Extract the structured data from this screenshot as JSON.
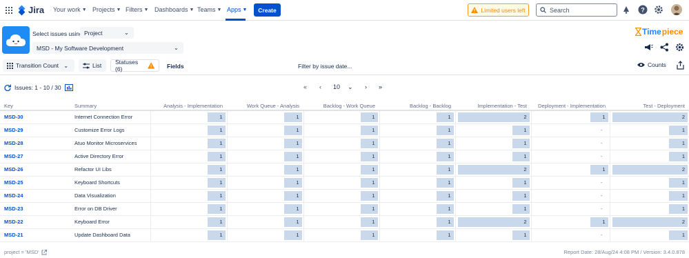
{
  "nav": {
    "logo_text": "Jira",
    "items": [
      {
        "label": "Your work"
      },
      {
        "label": "Projects"
      },
      {
        "label": "Filters"
      },
      {
        "label": "Dashboards"
      },
      {
        "label": "Teams"
      },
      {
        "label": "Apps"
      }
    ],
    "active_item": "Apps",
    "create_label": "Create",
    "limited_users_label": "Limited users left",
    "search_placeholder": "Search",
    "brand_color": "#0052cc"
  },
  "app": {
    "select_label": "Select issues using",
    "select_type": "Project",
    "project_value": "MSD - My Software Development",
    "logo_text_1": "Time",
    "logo_text_2": "piece"
  },
  "toolbar": {
    "transition_count_label": "Transition Count",
    "list_label": "List",
    "statuses_label": "Statuses (6)",
    "fields_label": "Fields",
    "filter_label": "Filter by issue date...",
    "counts_label": "Counts"
  },
  "pagination": {
    "issues_info": "Issues: 1 - 10 / 30",
    "page_size": "10",
    "first": "«",
    "prev": "‹",
    "next": "›",
    "last": "»"
  },
  "table": {
    "columns": [
      "Key",
      "Summary",
      "Analysis - Implementation",
      "Work Queue - Analysis",
      "Backlog - Work Queue",
      "Backlog - Backlog",
      "Implementation - Test",
      "Deployment - Implementation",
      "Test - Deployment"
    ],
    "rows": [
      {
        "key": "MSD-30",
        "summary": "Internet Connection Error",
        "values": [
          "1",
          "1",
          "1",
          "1",
          "2",
          "1",
          "2"
        ]
      },
      {
        "key": "MSD-29",
        "summary": "Customize Error Logs",
        "values": [
          "1",
          "1",
          "1",
          "1",
          "1",
          "-",
          "1"
        ]
      },
      {
        "key": "MSD-28",
        "summary": "Atuo Monitor Microservices",
        "values": [
          "1",
          "1",
          "1",
          "1",
          "1",
          "-",
          "1"
        ]
      },
      {
        "key": "MSD-27",
        "summary": "Active Directory Error",
        "values": [
          "1",
          "1",
          "1",
          "1",
          "1",
          "-",
          "1"
        ]
      },
      {
        "key": "MSD-26",
        "summary": "Refactor UI Libs",
        "values": [
          "1",
          "1",
          "1",
          "1",
          "2",
          "1",
          "2"
        ]
      },
      {
        "key": "MSD-25",
        "summary": "Keyboard Shortcuts",
        "values": [
          "1",
          "1",
          "1",
          "1",
          "1",
          "-",
          "1"
        ]
      },
      {
        "key": "MSD-24",
        "summary": "Data Visualization",
        "values": [
          "1",
          "1",
          "1",
          "1",
          "1",
          "-",
          "1"
        ]
      },
      {
        "key": "MSD-23",
        "summary": "Error on DB Driver",
        "values": [
          "1",
          "1",
          "1",
          "1",
          "1",
          "-",
          "1"
        ]
      },
      {
        "key": "MSD-22",
        "summary": "Keyboard Error",
        "values": [
          "1",
          "1",
          "1",
          "1",
          "2",
          "1",
          "2"
        ]
      },
      {
        "key": "MSD-21",
        "summary": "Update Dashboard Data",
        "values": [
          "1",
          "1",
          "1",
          "1",
          "1",
          "-",
          "1"
        ]
      }
    ],
    "bar_color": "#c9d9eb"
  },
  "footer": {
    "jql": "project = 'MSD'",
    "report_info": "Report Date: 28/Aug/24 4:08 PM / Version: 3.4.0.878"
  }
}
